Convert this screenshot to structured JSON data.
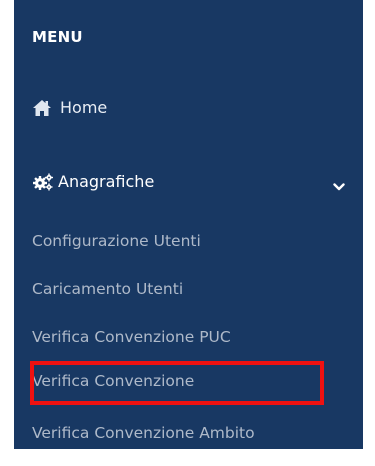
{
  "menu": {
    "header": "MENU",
    "home": {
      "label": "Home",
      "icon": "home-icon"
    },
    "anagrafiche": {
      "label": "Anagrafiche",
      "icon": "cogs-icon",
      "expanded": true,
      "toggle_icon": "chevron-down-icon",
      "items": [
        {
          "label": "Configurazione Utenti"
        },
        {
          "label": "Caricamento Utenti"
        },
        {
          "label": "Verifica Convenzione PUC"
        },
        {
          "label": "Verifica Convenzione",
          "highlighted": true
        },
        {
          "label": "Verifica Convenzione Ambito"
        }
      ]
    }
  },
  "colors": {
    "sidebar_bg": "#183863",
    "submenu_text": "#aeb9c9",
    "highlight": "#ee1111"
  }
}
